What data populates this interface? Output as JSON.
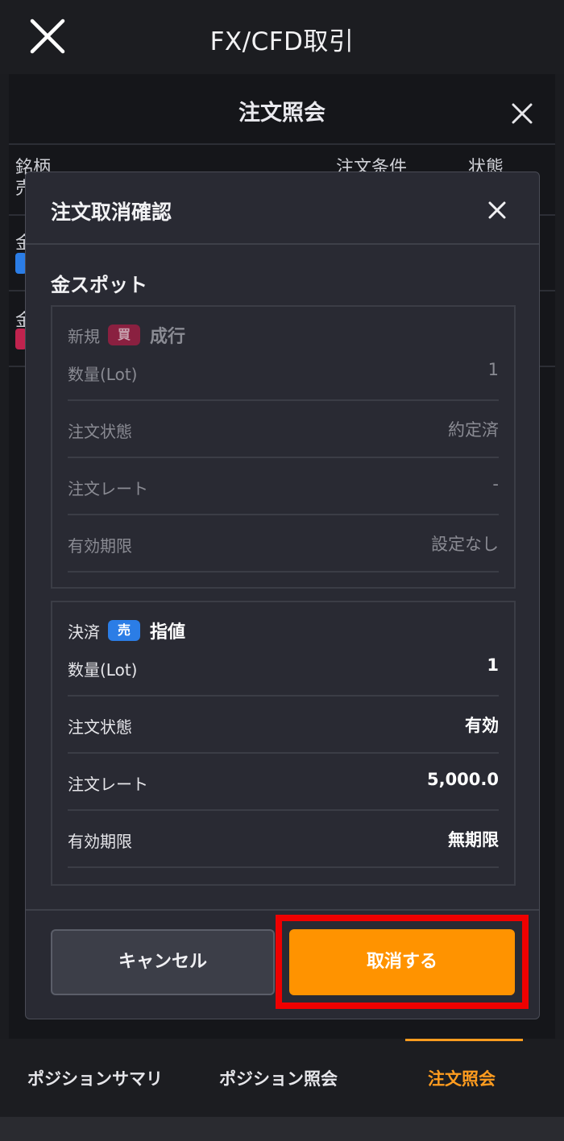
{
  "app": {
    "title": "FX/CFD取引"
  },
  "sheet": {
    "title": "注文照会",
    "columns": {
      "name": "銘柄",
      "name_sub": "売",
      "condition": "注文条件",
      "status": "状態"
    },
    "row_fragments": [
      "金",
      "金"
    ]
  },
  "dialog": {
    "title": "注文取消確認",
    "symbol": "金スポット",
    "orders": [
      {
        "kind": "新規",
        "side": "買",
        "order_type": "成行",
        "rows": [
          {
            "label": "数量(Lot)",
            "value": "1"
          },
          {
            "label": "注文状態",
            "value": "約定済"
          },
          {
            "label": "注文レート",
            "value": "-"
          },
          {
            "label": "有効期限",
            "value": "設定なし"
          }
        ]
      },
      {
        "kind": "決済",
        "side": "売",
        "order_type": "指値",
        "rows": [
          {
            "label": "数量(Lot)",
            "value": "1"
          },
          {
            "label": "注文状態",
            "value": "有効"
          },
          {
            "label": "注文レート",
            "value": "5,000.0"
          },
          {
            "label": "有効期限",
            "value": "無期限"
          }
        ]
      }
    ],
    "cancel_label": "キャンセル",
    "confirm_label": "取消する"
  },
  "tabs": [
    {
      "label": "ポジションサマリ",
      "active": false
    },
    {
      "label": "ポジション照会",
      "active": false
    },
    {
      "label": "注文照会",
      "active": true
    }
  ],
  "colors": {
    "accent": "#ff9300",
    "buy_badge": "#8a2040",
    "sell_badge": "#2b7de6",
    "highlight": "#ef0000"
  }
}
